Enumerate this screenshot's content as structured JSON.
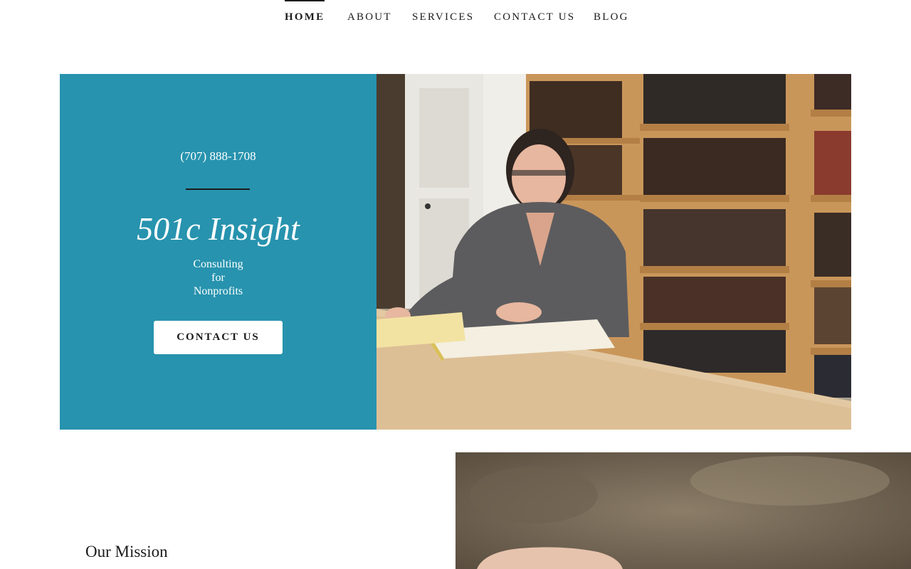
{
  "nav": {
    "items": [
      {
        "label": "HOME",
        "active": true
      },
      {
        "label": "ABOUT",
        "active": false
      },
      {
        "label": "SERVICES",
        "active": false
      },
      {
        "label": "CONTACT US",
        "active": false
      },
      {
        "label": "BLOG",
        "active": false
      }
    ]
  },
  "hero": {
    "phone": "(707) 888-1708",
    "brand": "501c Insight",
    "tagline_lines": [
      "Consulting",
      "for",
      "Nonprofits"
    ],
    "cta_label": "CONTACT US",
    "photo_icon": "woman-at-desk-with-bookshelves-photo"
  },
  "mission": {
    "title": "Our Mission",
    "photo_icon": "hand-on-blurred-background-photo"
  },
  "colors": {
    "accent": "#2793ae",
    "text": "#1b1b1b",
    "background": "#ffffff"
  }
}
